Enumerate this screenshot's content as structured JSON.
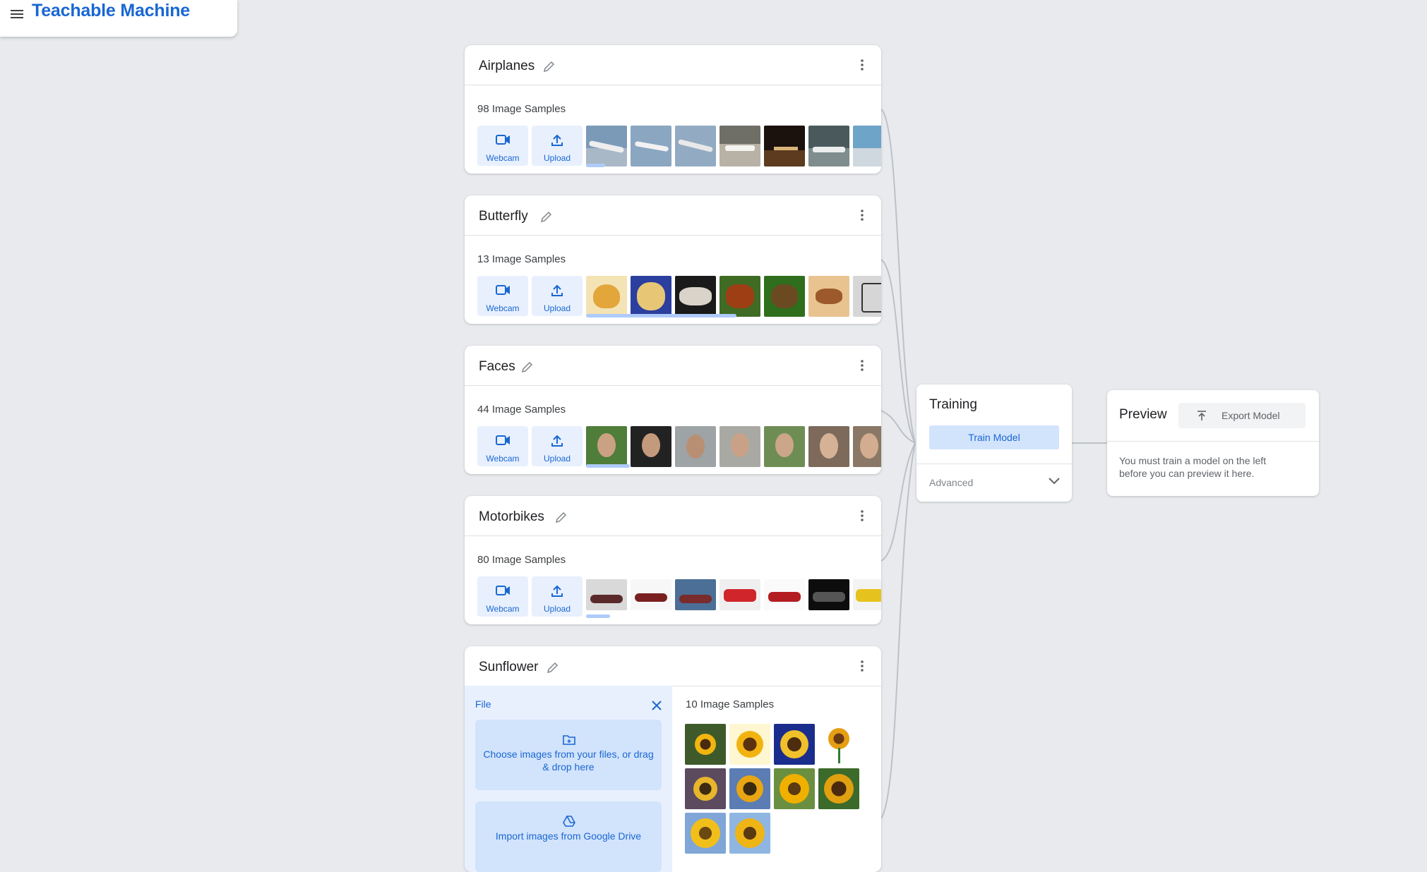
{
  "app": {
    "title": "Teachable Machine"
  },
  "classes": [
    {
      "name": "Airplanes",
      "samples": "98 Image Samples",
      "webcam_label": "Webcam",
      "upload_label": "Upload"
    },
    {
      "name": "Butterfly",
      "samples": "13 Image Samples",
      "webcam_label": "Webcam",
      "upload_label": "Upload"
    },
    {
      "name": "Faces",
      "samples": "44 Image Samples",
      "webcam_label": "Webcam",
      "upload_label": "Upload"
    },
    {
      "name": "Motorbikes",
      "samples": "80 Image Samples",
      "webcam_label": "Webcam",
      "upload_label": "Upload"
    }
  ],
  "sunflower": {
    "name": "Sunflower",
    "file_label": "File",
    "choose_label": "Choose images from your files, or drag & drop here",
    "drive_label": "Import images from Google Drive",
    "samples": "10 Image Samples"
  },
  "training": {
    "title": "Training",
    "train_button": "Train Model",
    "advanced_label": "Advanced"
  },
  "preview": {
    "title": "Preview",
    "export_button": "Export Model",
    "message": "You must train a model on the left before you can preview it here."
  },
  "colors": {
    "accent": "#1967d2",
    "button_bg": "#e8f0fe",
    "background": "#e8eaed"
  },
  "icons": [
    "menu-icon",
    "pencil-icon",
    "more-vert-icon",
    "webcam-icon",
    "upload-icon",
    "close-icon",
    "folder-add-icon",
    "google-drive-icon",
    "chevron-down-icon",
    "export-icon"
  ]
}
